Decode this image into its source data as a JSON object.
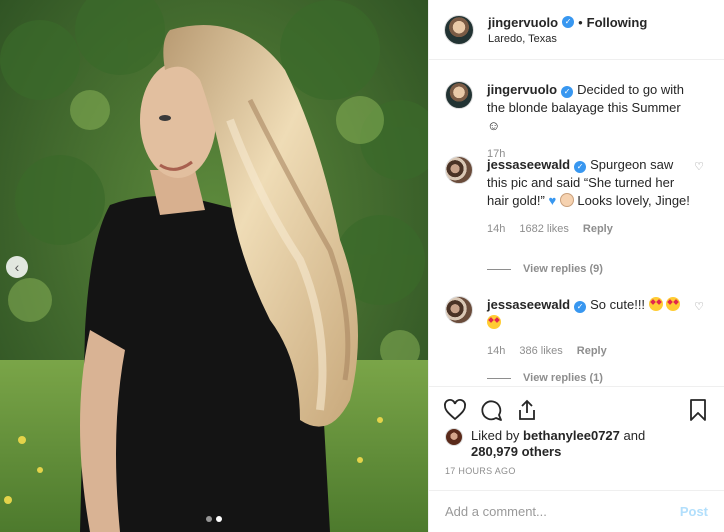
{
  "post": {
    "author": "jingervuolo",
    "location": "Laredo, Texas",
    "follow_separator": "•",
    "follow_status": "Following"
  },
  "caption": {
    "username": "jingervuolo",
    "text": "Decided to go with the blonde balayage this Summer ☺",
    "time": "17h"
  },
  "comments": [
    {
      "username": "jessaseewald",
      "text_before": "Spurgeon saw this pic and said “She turned her hair gold!”",
      "emoji_1": "♥",
      "text_after": "Looks lovely, Jinge!",
      "time": "14h",
      "likes": "1682 likes",
      "reply": "Reply",
      "view_replies": "View replies (9)"
    },
    {
      "username": "jessaseewald",
      "text": "So cute!!!",
      "time": "14h",
      "likes": "386 likes",
      "reply": "Reply",
      "view_replies": "View replies (1)"
    }
  ],
  "liked_by": {
    "prefix": "Liked by",
    "user": "bethanylee0727",
    "and": "and",
    "count": "280,979 others"
  },
  "timestamp": "17 HOURS AGO",
  "add_comment": {
    "placeholder": "Add a comment...",
    "post_label": "Post"
  },
  "carousel": {
    "prev_glyph": "‹",
    "slide_count": 2,
    "active_slide": 2
  },
  "colors": {
    "verified": "#3897f0",
    "post_disabled": "#b2dffc"
  },
  "icons": [
    "heart-icon",
    "comment-icon",
    "share-icon",
    "bookmark-icon",
    "verified-icon",
    "chevron-left-icon"
  ]
}
